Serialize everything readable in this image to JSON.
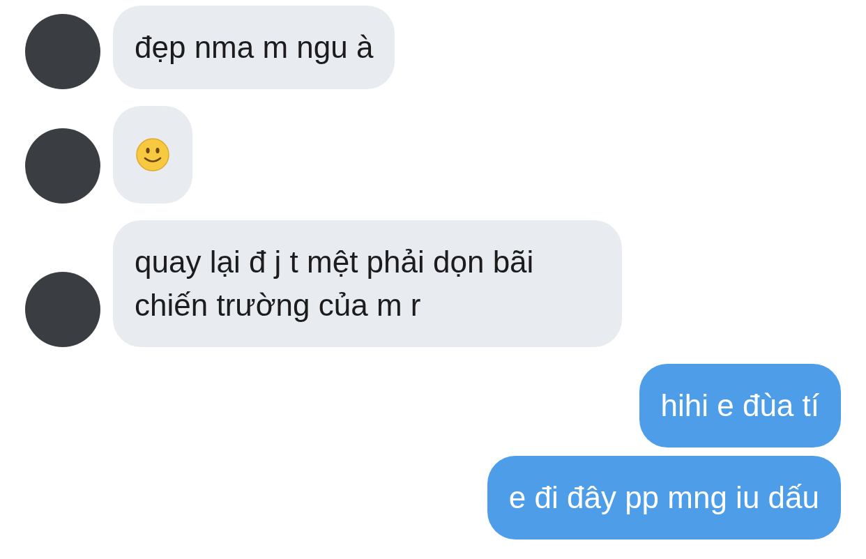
{
  "messages": [
    {
      "kind": "received",
      "text": "đẹp nma m ngu à"
    },
    {
      "kind": "emoji"
    },
    {
      "kind": "received",
      "text": "quay lại đ j t mệt phải dọn bãi chiến trường của m r"
    },
    {
      "kind": "sent",
      "text": "hihi e đùa tí"
    },
    {
      "kind": "sent",
      "text": "e đi đây pp mng iu dấu"
    }
  ]
}
